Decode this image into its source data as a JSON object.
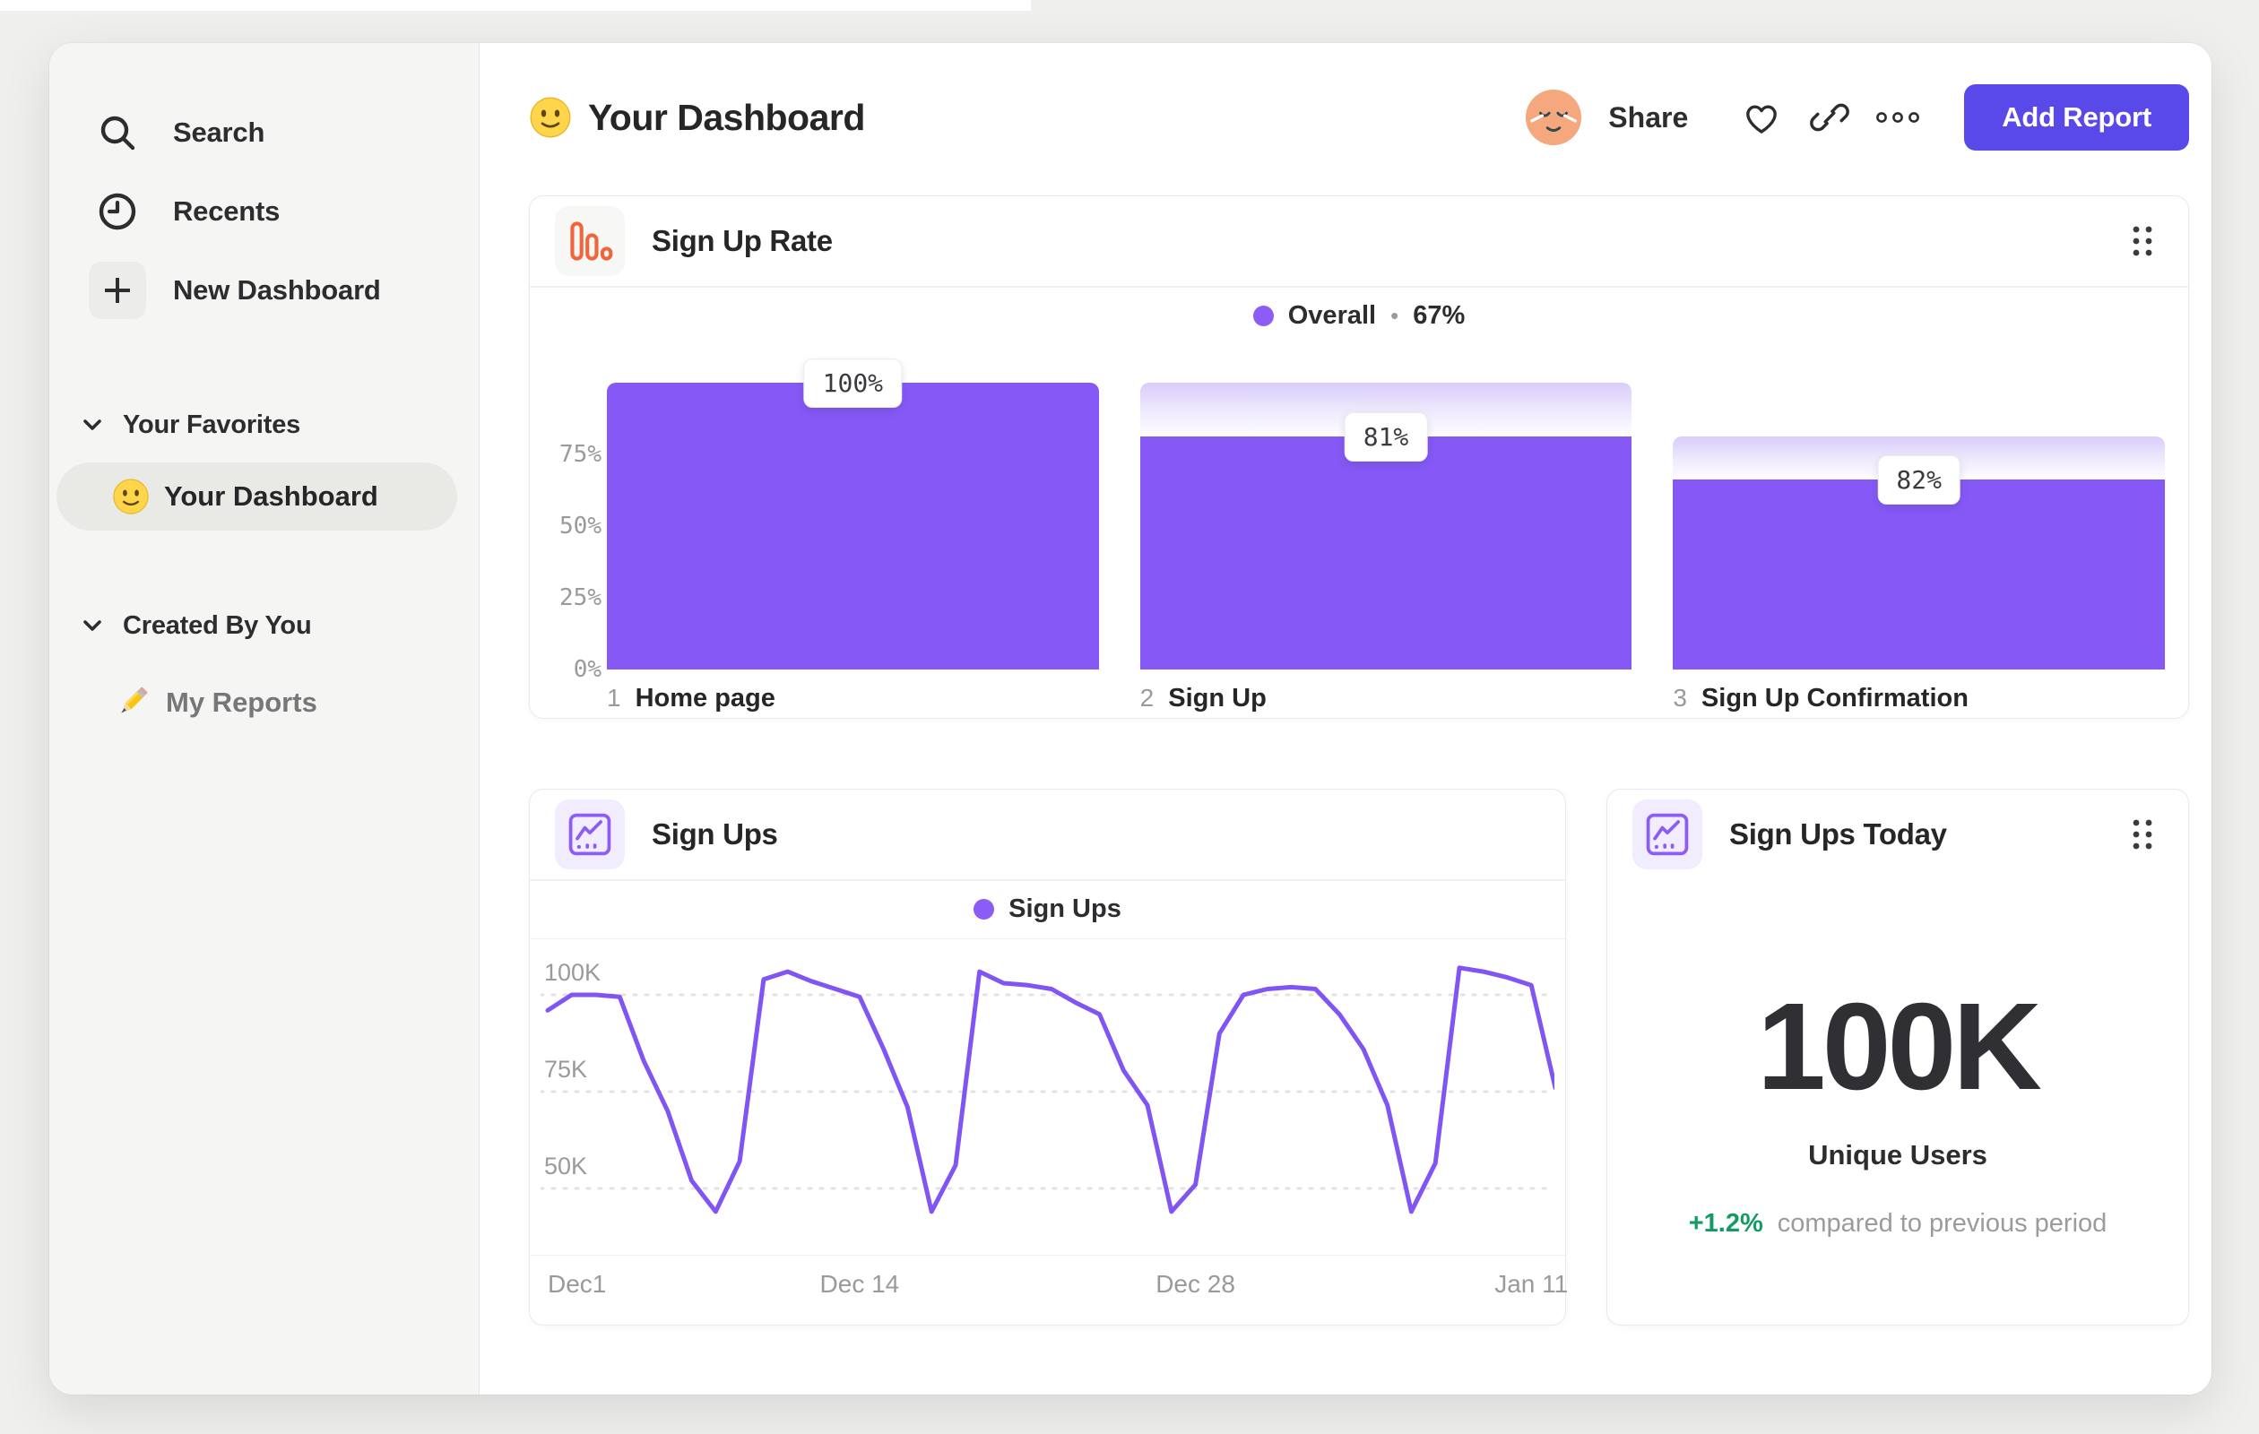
{
  "colors": {
    "accent_purple": "#8659f6",
    "button_purple": "#5a49e9",
    "funnel_cap_gradient_top": "#d9cdfa",
    "orange_icon": "#f0663a",
    "green_positive": "#129b62",
    "sidebar_bg": "#f5f5f3",
    "page_bg": "#efefee",
    "text_dark": "#2d2d30",
    "text_gray": "#9a9a9a"
  },
  "sidebar": {
    "search": "Search",
    "recents": "Recents",
    "new_dashboard": "New Dashboard",
    "favorites_header": "Your Favorites",
    "favorite_item": "Your Dashboard",
    "favorite_item_icon": "slightly-smiling-face-emoji",
    "created_header": "Created By You",
    "reports_item": "My Reports",
    "reports_item_icon": "pencil-emoji"
  },
  "header": {
    "title_icon": "slightly-smiling-face-emoji",
    "title": "Your Dashboard",
    "share": "Share",
    "add_report": "Add Report",
    "icons": [
      "avatar",
      "heart-icon",
      "link-icon",
      "more-options-icon"
    ]
  },
  "cards": {
    "funnel": {
      "title": "Sign Up Rate",
      "icon": "bar-chart-icon",
      "legend_label": "Overall",
      "legend_sep": "•",
      "legend_value": "67%"
    },
    "line": {
      "title": "Sign Ups",
      "icon": "line-chart-icon",
      "legend_label": "Sign Ups"
    },
    "stat": {
      "title": "Sign Ups Today",
      "icon": "line-chart-icon"
    }
  },
  "chart_data": [
    {
      "type": "bar",
      "subtype": "funnel",
      "title": "Sign Up Rate",
      "legend": "Overall",
      "overall_conversion_pct": 67,
      "ylim": [
        0,
        100
      ],
      "y_ticks": [
        {
          "label": "75%",
          "pct": 75
        },
        {
          "label": "50%",
          "pct": 50
        },
        {
          "label": "25%",
          "pct": 25
        },
        {
          "label": "0%",
          "pct": 0
        }
      ],
      "steps": [
        {
          "step": 1,
          "label": "Home page",
          "badge": "100%",
          "conversion_from_previous_pct": 100,
          "cumulative_pct": 100
        },
        {
          "step": 2,
          "label": "Sign Up",
          "badge": "81%",
          "conversion_from_previous_pct": 81,
          "cumulative_pct": 81
        },
        {
          "step": 3,
          "label": "Sign Up Confirmation",
          "badge": "82%",
          "conversion_from_previous_pct": 82,
          "cumulative_pct": 66
        }
      ]
    },
    {
      "type": "line",
      "title": "Sign Ups",
      "legend_position": "top center",
      "grid": "dashed horizontal",
      "x_interval": "daily",
      "x_range": [
        "Dec 1",
        "Jan 12"
      ],
      "x_ticks": [
        {
          "label": "Dec1",
          "index": 0
        },
        {
          "label": "Dec 14",
          "index": 13
        },
        {
          "label": "Dec 28",
          "index": 27
        },
        {
          "label": "Jan 11",
          "index": 41
        }
      ],
      "y_unit": "thousands",
      "y_ticks": [
        {
          "label": "100K",
          "value": 100
        },
        {
          "label": "75K",
          "value": 75
        },
        {
          "label": "50K",
          "value": 50
        }
      ],
      "series": [
        {
          "name": "Sign Ups",
          "values": [
            96,
            100,
            100,
            99.5,
            83,
            70,
            52,
            44,
            57,
            104,
            106,
            103.5,
            101.5,
            99.5,
            86,
            71,
            44,
            56,
            106,
            103,
            102.5,
            101.5,
            98,
            95,
            80.5,
            71.5,
            44,
            51,
            90,
            100,
            101.5,
            102,
            101.5,
            95,
            86,
            71.5,
            44,
            56.5,
            107,
            106,
            104.5,
            102.5,
            76
          ]
        }
      ]
    },
    {
      "type": "stat",
      "title": "Sign Ups Today",
      "value": "100K",
      "metric": "Unique Users",
      "change_pct": "+1.2%",
      "change_note": "compared to previous period"
    }
  ],
  "stat": {
    "value": "100K",
    "metric": "Unique Users",
    "delta": "+1.2%",
    "note": "compared to previous period"
  }
}
